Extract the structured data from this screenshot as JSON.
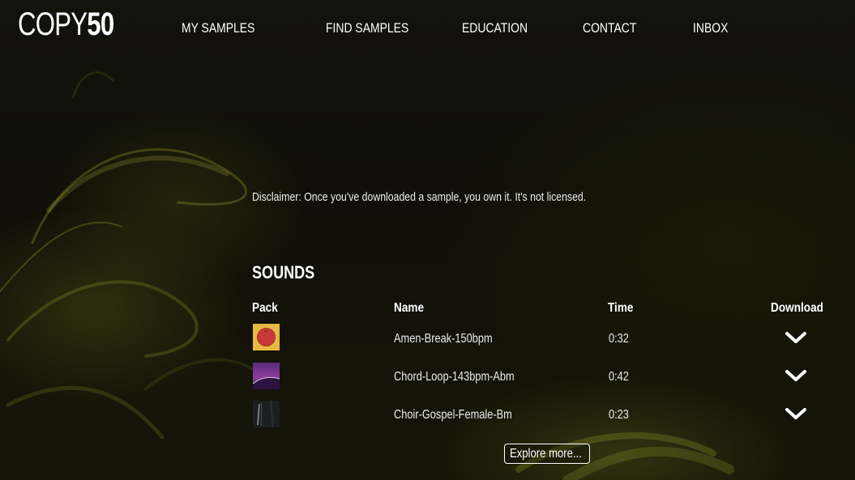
{
  "logo": {
    "light": "COPY",
    "bold": "50"
  },
  "nav": {
    "items": [
      {
        "label": "MY SAMPLES"
      },
      {
        "label": "FIND SAMPLES"
      },
      {
        "label": "EDUCATION"
      },
      {
        "label": "CONTACT"
      },
      {
        "label": "INBOX"
      }
    ]
  },
  "main": {
    "disclaimer": "Disclaimer: Once you've downloaded a sample, you own it. It's not licensed.",
    "section_title": "SOUNDS",
    "table": {
      "headers": {
        "pack": "Pack",
        "name": "Name",
        "time": "Time",
        "download": "Download"
      },
      "rows": [
        {
          "name": "Amen-Break-150bpm",
          "time": "0:32",
          "pack_icon": "red-circle-on-yellow-art",
          "download_icon": "chevron-down-icon"
        },
        {
          "name": "Chord-Loop-143bpm-Abm",
          "time": "0:42",
          "pack_icon": "purple-horizon-art",
          "download_icon": "chevron-down-icon"
        },
        {
          "name": "Choir-Gospel-Female-Bm",
          "time": "0:23",
          "pack_icon": "dark-texture-art",
          "download_icon": "chevron-down-icon"
        }
      ]
    },
    "explore_button": "Explore more..."
  },
  "colors": {
    "background": "#0d0d05",
    "smoke_accent": "#8a8a2a",
    "text": "#ffffff"
  }
}
